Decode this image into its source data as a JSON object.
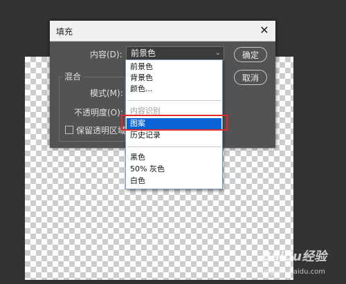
{
  "dialog": {
    "title": "填充",
    "close_glyph": "✕",
    "content_label": "内容(D):",
    "content_value": "前景色",
    "ok_label": "确定",
    "cancel_label": "取消",
    "blend_title": "混合",
    "mode_label": "模式(M):",
    "opacity_label": "不透明度(O):",
    "preserve_label": "保留透明区域"
  },
  "dropdown": {
    "groups": [
      [
        "前景色",
        "背景色",
        "颜色..."
      ],
      [
        "内容识别",
        "图案",
        "历史记录"
      ],
      [
        "黑色",
        "50% 灰色",
        "白色"
      ]
    ],
    "disabled_item": "内容识别",
    "selected_item": "图案"
  },
  "watermark": {
    "brand": "Baidu经验",
    "url": "jingyan.baidu.com"
  },
  "colors": {
    "highlight": "#e0282a",
    "selection": "#0a64d7",
    "dialog_bg": "#535353"
  }
}
